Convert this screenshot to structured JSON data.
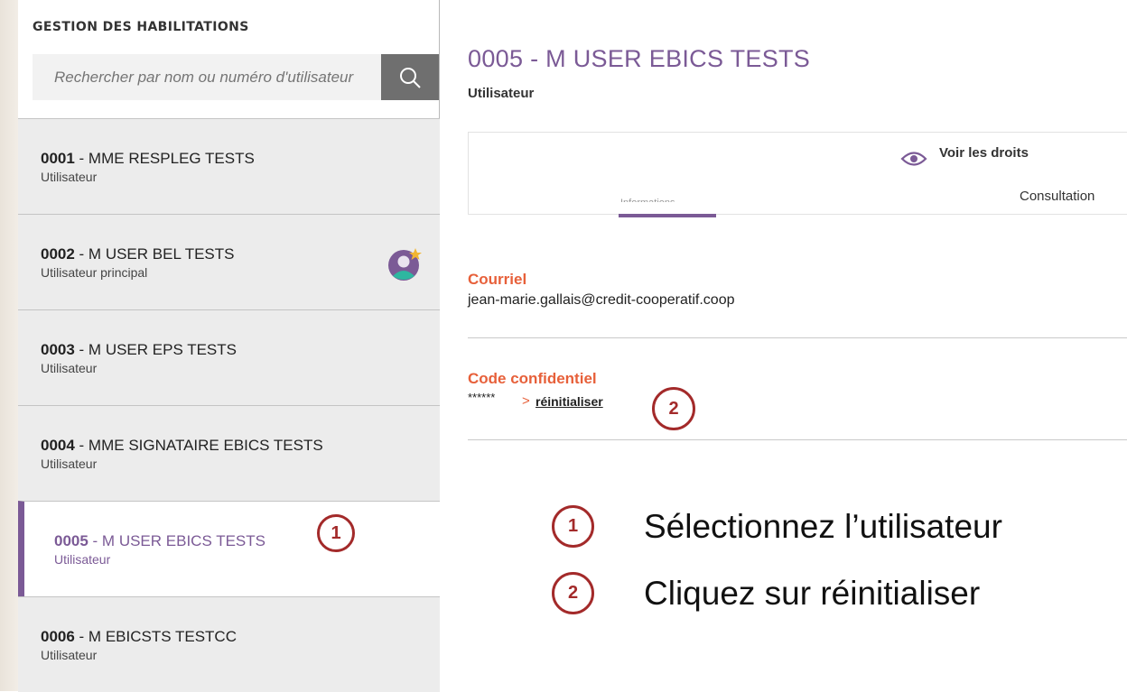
{
  "sidebar": {
    "title": "GESTION DES HABILITATIONS",
    "search_placeholder": "Rechercher par nom ou numéro d'utilisateur",
    "users": [
      {
        "num": "0001",
        "name": " - MME RESPLEG TESTS",
        "role": "Utilisateur"
      },
      {
        "num": "0002",
        "name": " - M USER BEL TESTS",
        "role": "Utilisateur principal"
      },
      {
        "num": "0003",
        "name": " - M USER EPS TESTS",
        "role": "Utilisateur"
      },
      {
        "num": "0004",
        "name": " - MME SIGNATAIRE EBICS TESTS",
        "role": "Utilisateur"
      },
      {
        "num": "0005",
        "name": " - M USER EBICS TESTS",
        "role": "Utilisateur"
      },
      {
        "num": "0006",
        "name": " - M EBICSTS TESTCC",
        "role": "Utilisateur"
      }
    ]
  },
  "main": {
    "title": "0005 - M USER EBICS TESTS",
    "subtitle": "Utilisateur",
    "tabs": {
      "voir_droits": "Voir les droits",
      "consultation": "Consultation",
      "informations": "Informations"
    },
    "courriel_label": "Courriel",
    "courriel_value": "jean-marie.gallais@credit-cooperatif.coop",
    "code_label": "Code confidentiel",
    "code_masked": "******",
    "reset_arrow": ">",
    "reset_link": "réinitialiser"
  },
  "steps": [
    {
      "num": "1",
      "text": "Sélectionnez l’utilisateur"
    },
    {
      "num": "2",
      "text": "Cliquez sur réinitialiser"
    }
  ],
  "colors": {
    "accent": "#7b5a96",
    "label": "#e7603a",
    "step": "#a32a2a"
  }
}
